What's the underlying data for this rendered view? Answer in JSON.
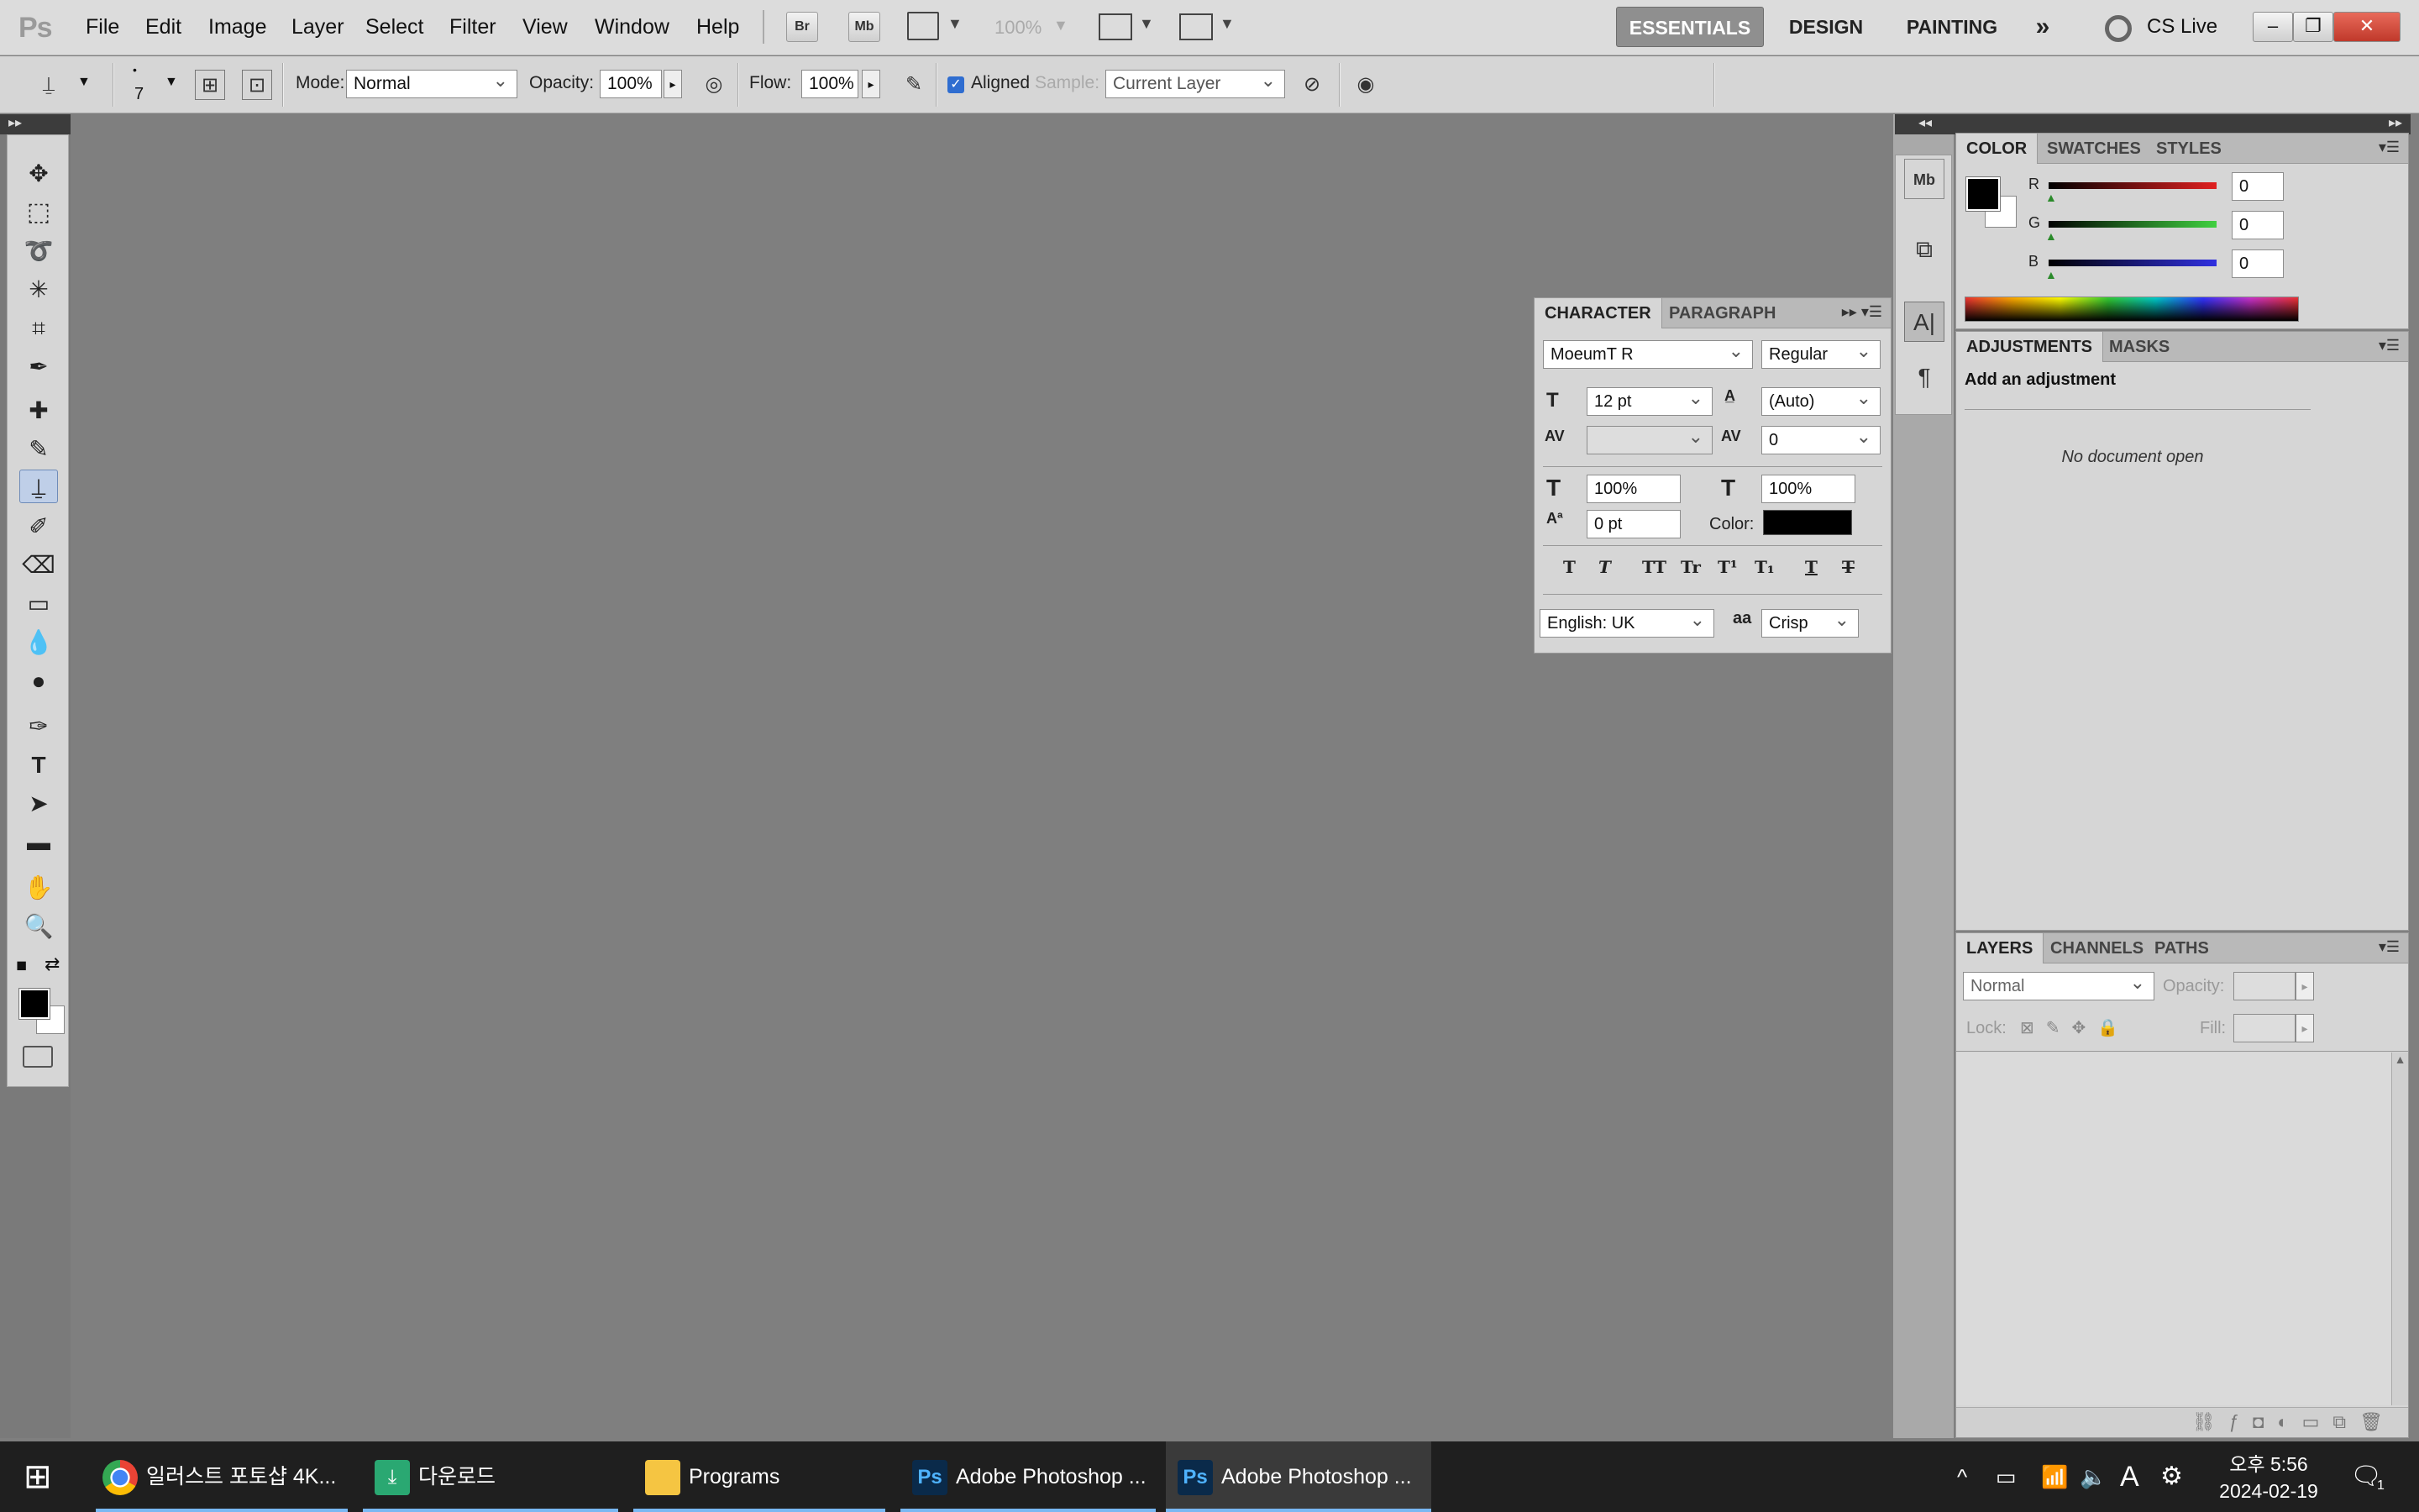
{
  "app": {
    "logo": "Ps"
  },
  "menus": [
    "File",
    "Edit",
    "Image",
    "Layer",
    "Select",
    "Filter",
    "View",
    "Window",
    "Help"
  ],
  "menubar": {
    "br": "Br",
    "mb": "Mb",
    "zoom": "100%"
  },
  "workspaces": [
    "ESSENTIALS",
    "DESIGN",
    "PAINTING"
  ],
  "cslive": "CS Live",
  "options": {
    "brush_size": "7",
    "mode_label": "Mode:",
    "mode_value": "Normal",
    "opacity_label": "Opacity:",
    "opacity_value": "100%",
    "flow_label": "Flow:",
    "flow_value": "100%",
    "aligned_label": "Aligned",
    "sample_label": "Sample:",
    "sample_value": "Current Layer"
  },
  "character": {
    "tabs": [
      "CHARACTER",
      "PARAGRAPH"
    ],
    "font": "MoeumT R",
    "style": "Regular",
    "size": "12 pt",
    "leading": "(Auto)",
    "kerning": "",
    "tracking": "0",
    "vscale": "100%",
    "hscale": "100%",
    "baseline": "0 pt",
    "color_label": "Color:",
    "language": "English: UK",
    "antialias": "Crisp",
    "aa_label": "aa"
  },
  "color_panel": {
    "tabs": [
      "COLOR",
      "SWATCHES",
      "STYLES"
    ],
    "r_label": "R",
    "g_label": "G",
    "b_label": "B",
    "r": "0",
    "g": "0",
    "b": "0"
  },
  "adjustments": {
    "tabs": [
      "ADJUSTMENTS",
      "MASKS"
    ],
    "heading": "Add an adjustment",
    "message": "No document open"
  },
  "layers": {
    "tabs": [
      "LAYERS",
      "CHANNELS",
      "PATHS"
    ],
    "blend": "Normal",
    "opacity_label": "Opacity:",
    "lock_label": "Lock:",
    "fill_label": "Fill:"
  },
  "taskbar": {
    "items": [
      "일러스트 포토샵 4K...",
      "다운로드",
      "Programs",
      "Adobe Photoshop ...",
      "Adobe Photoshop ..."
    ],
    "ime": "A",
    "time": "오후 5:56",
    "date": "2024-02-19",
    "notif": "1"
  },
  "colors": {
    "accent": "#79b8f3",
    "panel": "#d6d6d6",
    "workspace": "#7f7f7f"
  }
}
